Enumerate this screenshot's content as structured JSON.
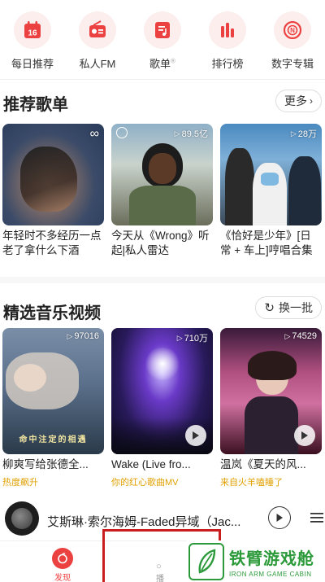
{
  "quick_nav": [
    {
      "label": "每日推荐",
      "icon": "calendar-icon",
      "calendar_day": "16"
    },
    {
      "label": "私人FM",
      "icon": "radio-icon"
    },
    {
      "label": "歌单",
      "icon": "playlist-icon",
      "superscript": "®"
    },
    {
      "label": "排行榜",
      "icon": "chart-bars-icon"
    },
    {
      "label": "数字专辑",
      "icon": "digital-album-icon"
    }
  ],
  "playlists": {
    "title": "推荐歌单",
    "more_label": "更多",
    "items": [
      {
        "title": "年轻时不多经历一点 老了拿什么下酒",
        "badge": "",
        "badge_icon": "infinity-icon"
      },
      {
        "title": "今天从《Wrong》听起|私人雷达",
        "badge": "89.5亿",
        "badge_icon": "play-triangle-icon"
      },
      {
        "title": "《恰好是少年》[日常 + 车上]哼唱合集",
        "badge": "28万",
        "badge_icon": "play-triangle-icon"
      }
    ]
  },
  "videos": {
    "title": "精选音乐视频",
    "refresh_label": "换一批",
    "items": [
      {
        "title": "柳爽写给张德全...",
        "badge": "97016",
        "subtitle": "热度飙升",
        "overlay_text": "命中注定的相遇"
      },
      {
        "title": "Wake (Live fro...",
        "badge": "710万",
        "subtitle": "你的红心歌曲MV"
      },
      {
        "title": "温岚《夏天的风...",
        "badge": "74529",
        "subtitle": "来自火羊嗑睡了"
      }
    ]
  },
  "mini_player": {
    "title": "艾斯琳·索尔海姆-Faded异域（Jac..."
  },
  "tab_bar": {
    "discover_label": "发现",
    "second_label": "播"
  },
  "watermark": {
    "cn": "铁臂游戏舱",
    "en": "IRON ARM GAME CABIN"
  },
  "colors": {
    "brand_red": "#ec4141",
    "icon_bg": "#fdeeee",
    "subtitle_gold": "#e0a000",
    "watermark_green": "#2c9a3a"
  }
}
